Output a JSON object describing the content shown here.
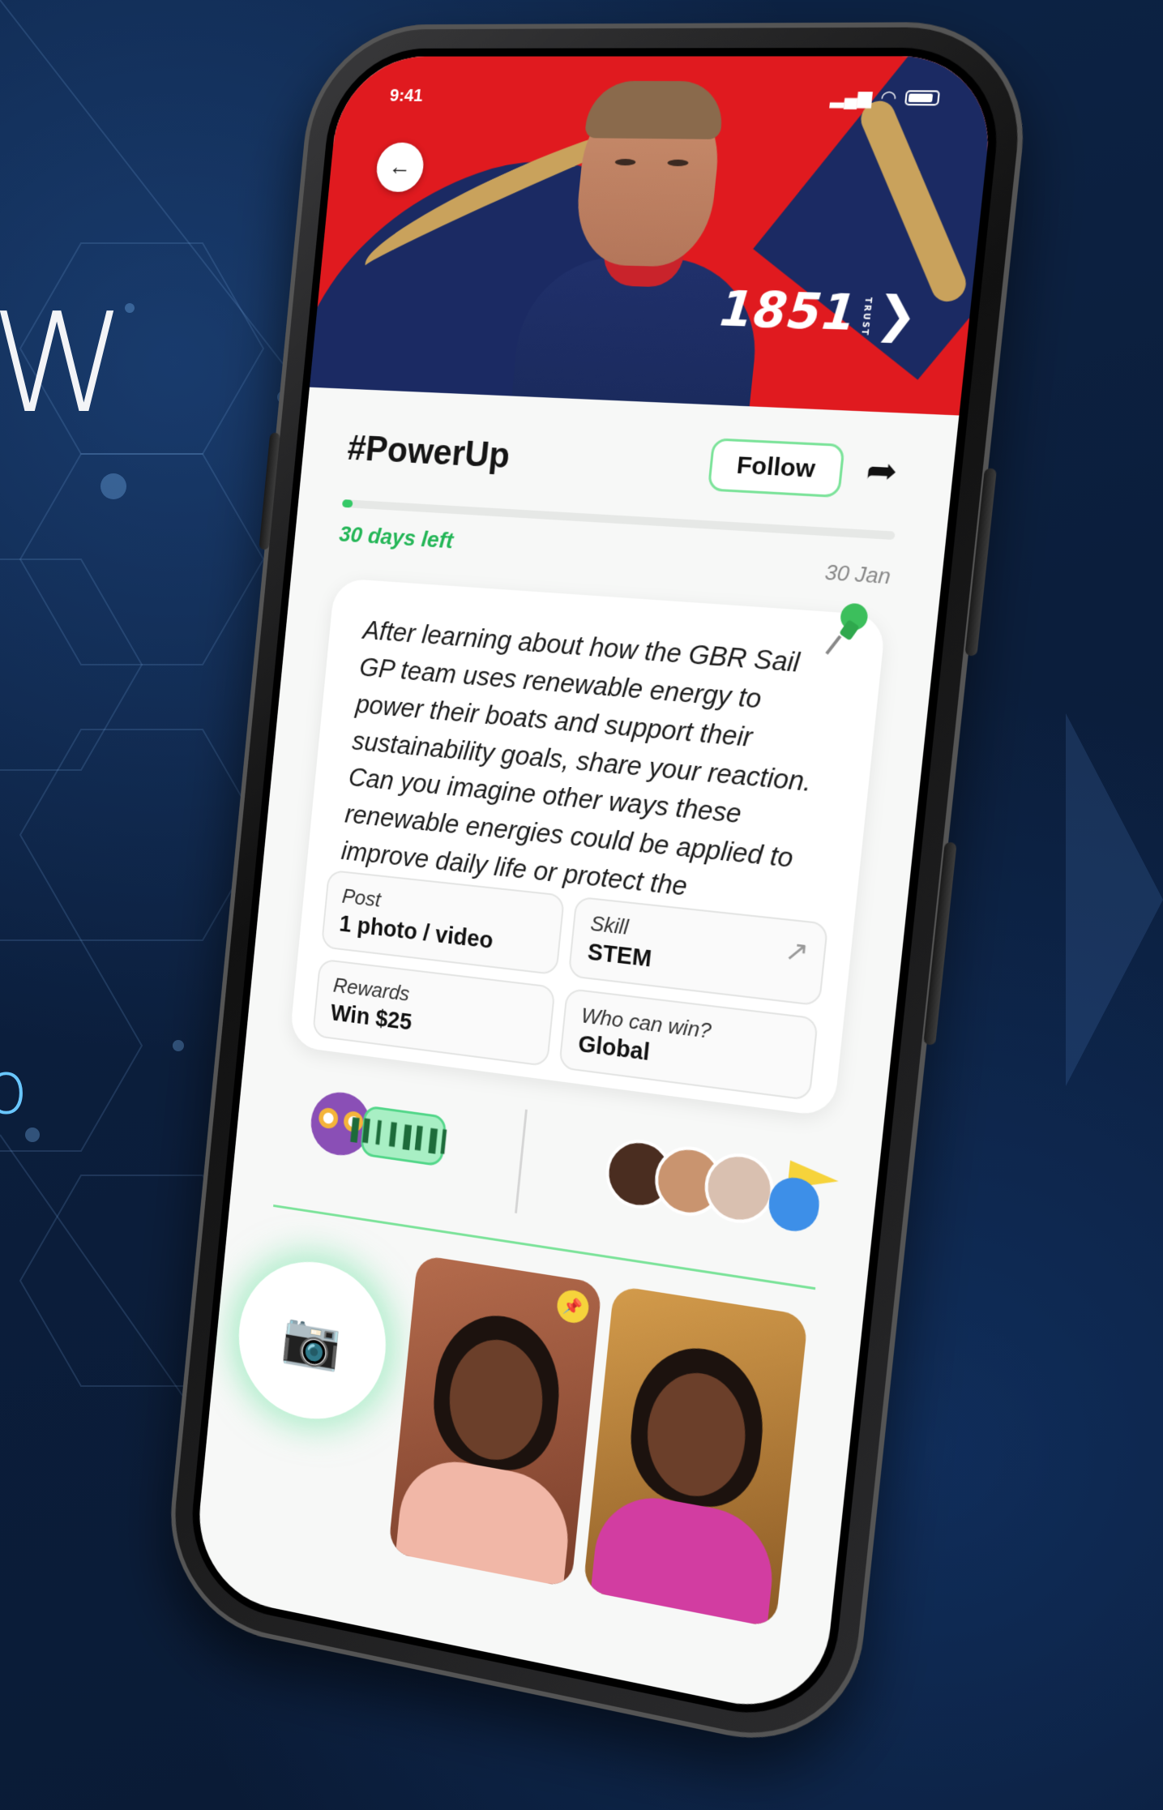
{
  "status": {
    "time": "9:41",
    "signal_icon": "signal-icon",
    "wifi_icon": "wifi-icon",
    "battery_icon": "battery-icon"
  },
  "hero": {
    "brand": "1851",
    "brand_sub": "TRUST",
    "brand_arrow": "❯",
    "back_icon": "arrow-left-icon"
  },
  "challenge": {
    "title": "#PowerUp",
    "follow_label": "Follow",
    "progress": 0.02,
    "days_left": "30 days left",
    "date": "30 Jan",
    "description": "After learning about how the GBR Sail GP team uses renewable energy to power their boats and support their sustainability goals, share your reaction. Can you imagine other ways these renewable energies could be applied to improve daily life or protect the environment?",
    "details": [
      {
        "label": "Post",
        "value": "1 photo / video"
      },
      {
        "label": "Skill",
        "value": "STEM"
      },
      {
        "label": "Rewards",
        "value": "Win $25"
      },
      {
        "label": "Who can win?",
        "value": "Global"
      }
    ]
  },
  "colors": {
    "accent": "#35c967",
    "hero_red": "#e01a1f",
    "hero_navy": "#1b2a63",
    "gold": "#c9a25c"
  }
}
